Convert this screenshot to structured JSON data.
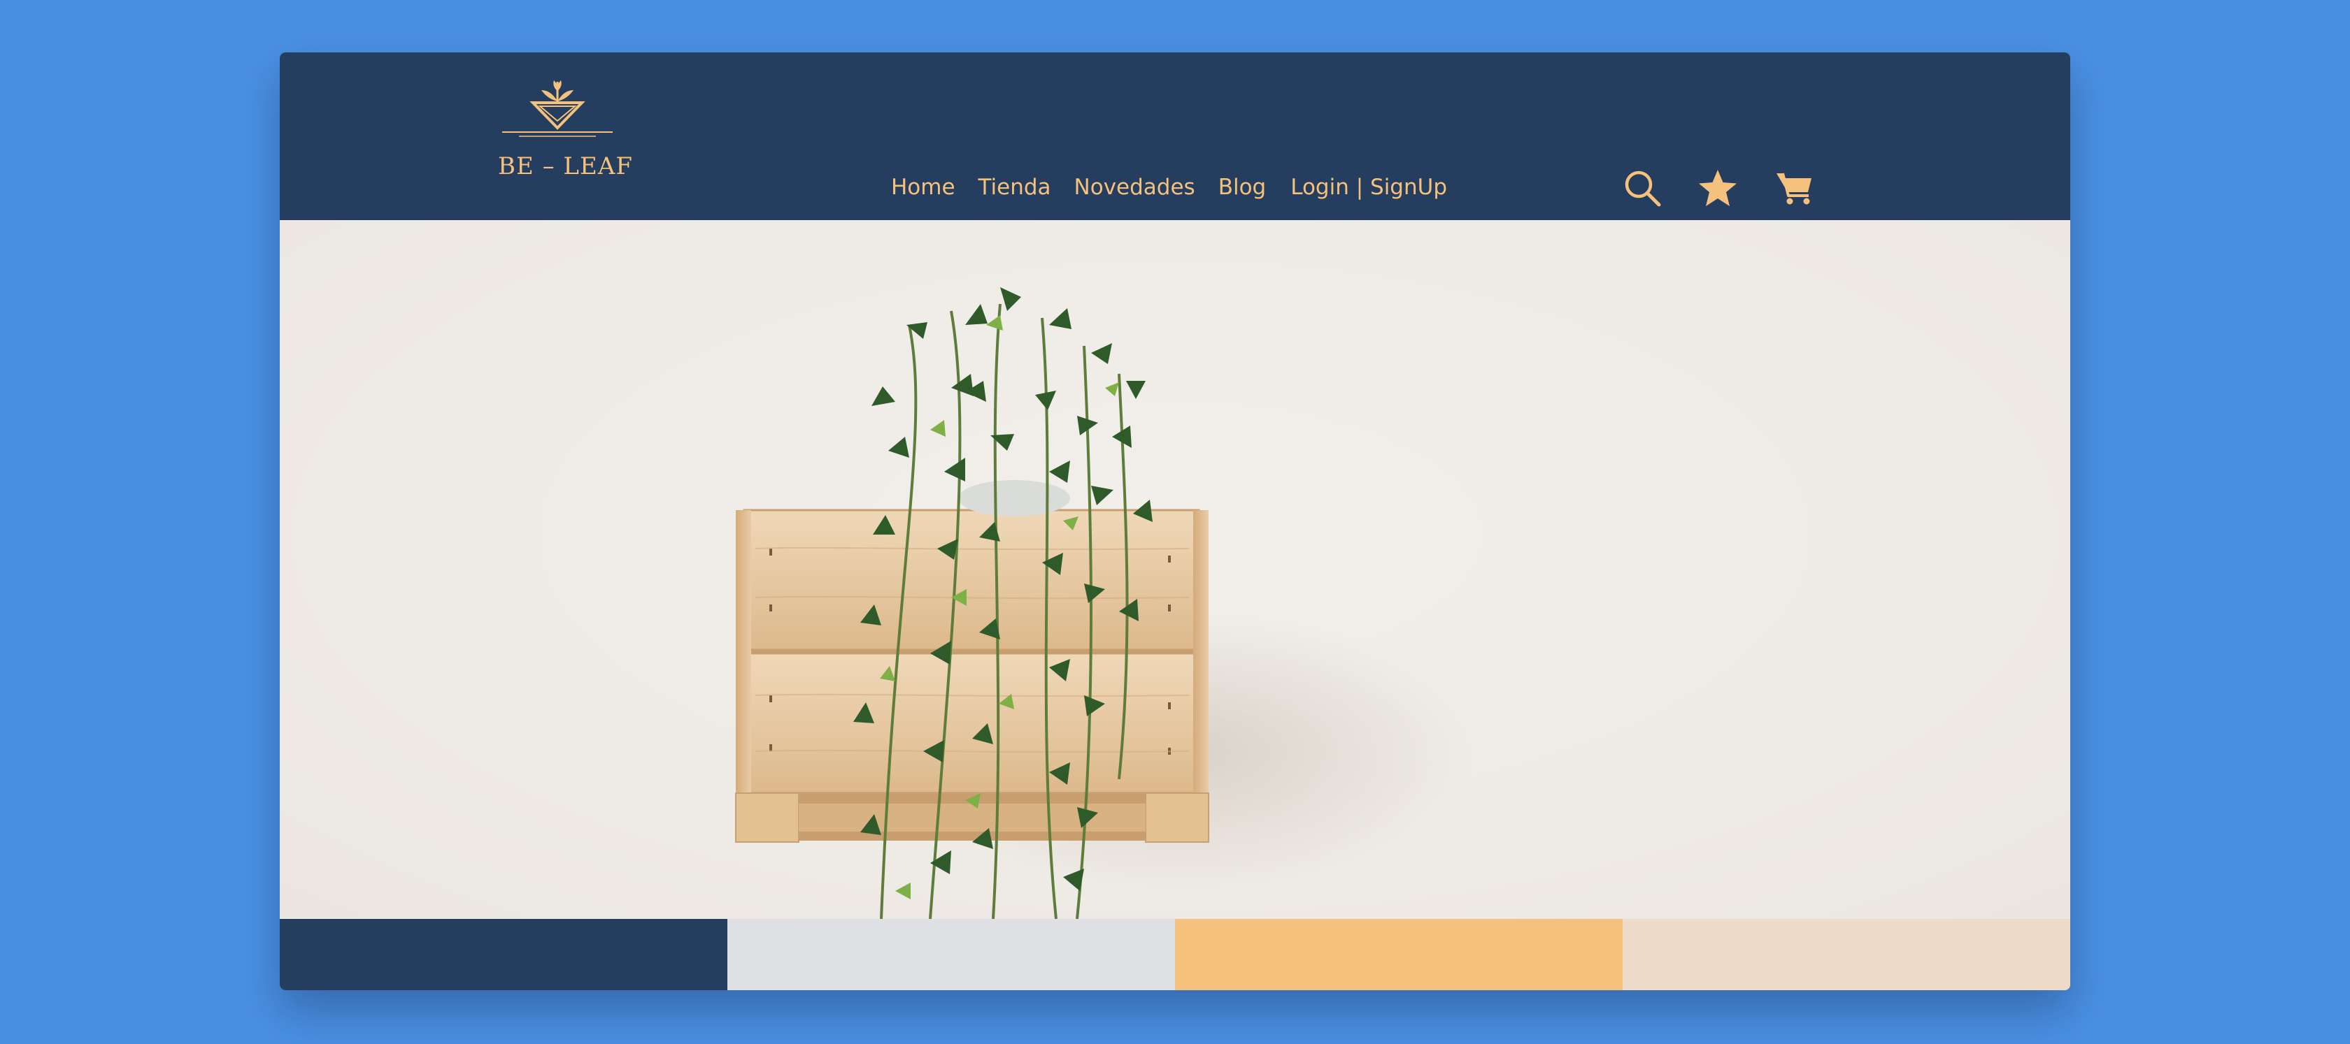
{
  "app": {
    "logo_text": "BE – LEAF"
  },
  "nav": {
    "links": [
      {
        "label": "Home"
      },
      {
        "label": "Tienda"
      },
      {
        "label": "Novedades"
      },
      {
        "label": "Blog"
      },
      {
        "label": "Login | SignUp"
      }
    ],
    "icons": [
      "search-icon",
      "star-icon",
      "cart-icon"
    ]
  },
  "colors": {
    "background": "#4a90e2",
    "navbar": "#253d5f",
    "accent": "#f4c27c",
    "hero_wall": "#f1eeea",
    "crate_wood": "#e6c9a2",
    "leaf_dark": "#2f5a2a",
    "leaf_light": "#7fb048"
  },
  "palette": {
    "swatches": [
      "#253d5f",
      "#dfe0e4",
      "#f4c27c",
      "#efdcc8"
    ]
  }
}
